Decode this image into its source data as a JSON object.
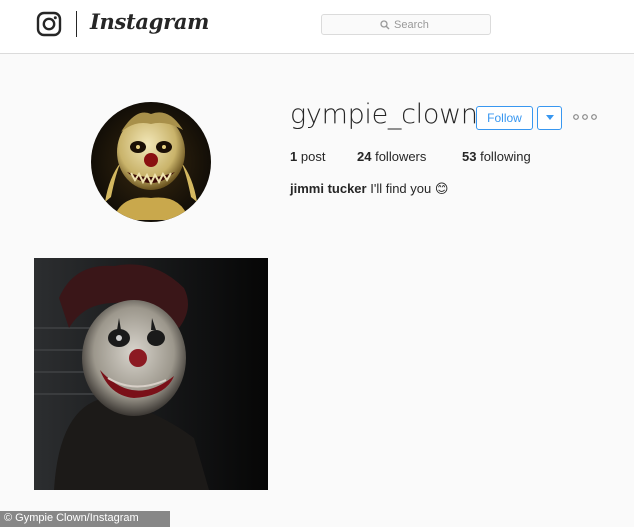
{
  "brand": {
    "wordmark": "Instagram",
    "logo_icon": "instagram-camera-icon"
  },
  "search": {
    "placeholder": "Search",
    "icon": "search-icon"
  },
  "profile": {
    "username": "gympie_clown",
    "follow_label": "Follow",
    "dropdown_icon": "caret-down-icon",
    "more_icon": "ellipsis-icon",
    "stats": {
      "posts_count": "1",
      "posts_label": "post",
      "followers_count": "24",
      "followers_label": "followers",
      "following_count": "53",
      "following_label": "following"
    },
    "bio": {
      "name": "jimmi tucker",
      "text": "I'll find you 😊"
    }
  },
  "colors": {
    "accent": "#3897f0",
    "text": "#262626",
    "border": "#dbdbdb",
    "background": "#fafafa"
  },
  "credit": "© Gympie Clown/Instagram"
}
